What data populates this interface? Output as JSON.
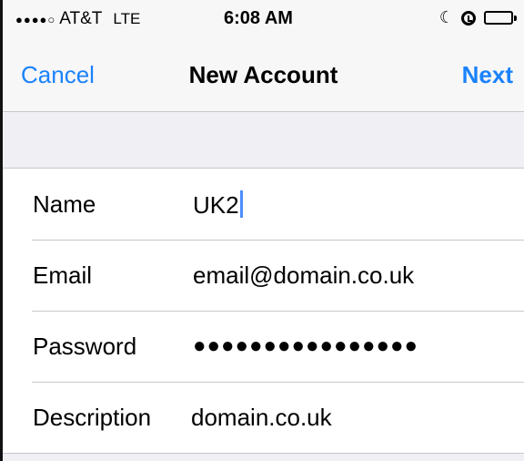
{
  "status_bar": {
    "signal": "●●●●○",
    "carrier": "AT&T",
    "network": "LTE",
    "time": "6:08 AM",
    "moon_glyph": "☾"
  },
  "nav": {
    "cancel_label": "Cancel",
    "title": "New Account",
    "next_label": "Next"
  },
  "form": {
    "rows": [
      {
        "label": "Name",
        "value": "UK2"
      },
      {
        "label": "Email",
        "value": "email@domain.co.uk"
      },
      {
        "label": "Password",
        "value": "●●●●●●●●●●●●●●●●"
      },
      {
        "label": "Description",
        "value": "domain.co.uk"
      }
    ]
  },
  "colors": {
    "accent": "#1a82fb",
    "caret": "#4c8dfb",
    "separator": "#c8c7cc",
    "grouped_background": "#efeff4"
  }
}
